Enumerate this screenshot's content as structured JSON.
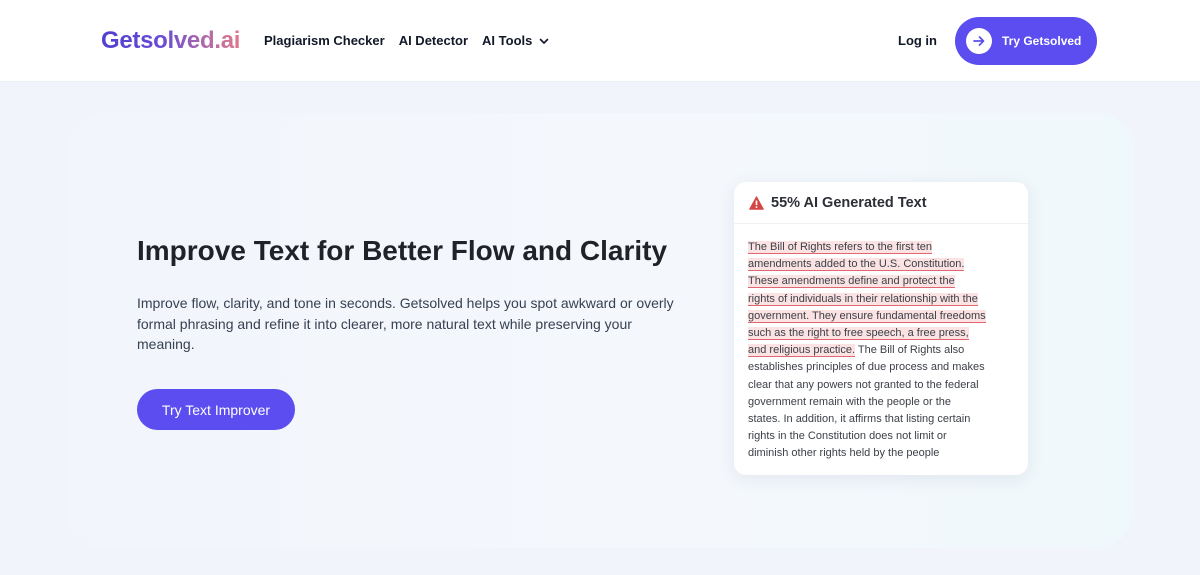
{
  "nav": {
    "logo": "Getsolved.ai",
    "links": [
      "Plagiarism Checker",
      "AI Detector"
    ],
    "tools_label": "AI Tools",
    "tools_icon": "chevron-down-icon",
    "login": "Log in",
    "try_button": "Try Getsolved",
    "try_button_icon": "arrow-right-icon"
  },
  "hero": {
    "title": "Improve Text for Better Flow and Clarity",
    "description": "Improve flow, clarity, and tone in seconds. Getsolved helps you spot awkward or overly formal phrasing and refine it into clearer, more natural text while preserving your meaning.",
    "cta": "Try Text Improver"
  },
  "card": {
    "icon": "warning-icon",
    "title": "55% AI Generated Text",
    "highlighted_lines": [
      "The Bill of Rights refers to the first ten",
      "amendments added to the U.S. Constitution.",
      "These amendments define and protect the",
      "rights of individuals in their relationship with the",
      "government. They ensure fundamental freedoms",
      "such as the right to free speech, a free press,",
      "and religious practice."
    ],
    "plain_first": " The Bill of Rights also",
    "plain_lines": [
      "establishes principles of due process and makes",
      "clear that any powers not granted to the federal",
      "government remain with the people or the",
      "states. In addition, it affirms that listing certain",
      "rights in the Constitution does not limit or",
      "diminish other rights held by the people"
    ]
  },
  "colors": {
    "brand": "#5b4df0",
    "highlight_bg": "#fbe3e3",
    "highlight_underline": "#e0666f",
    "warning": "#d64545"
  }
}
